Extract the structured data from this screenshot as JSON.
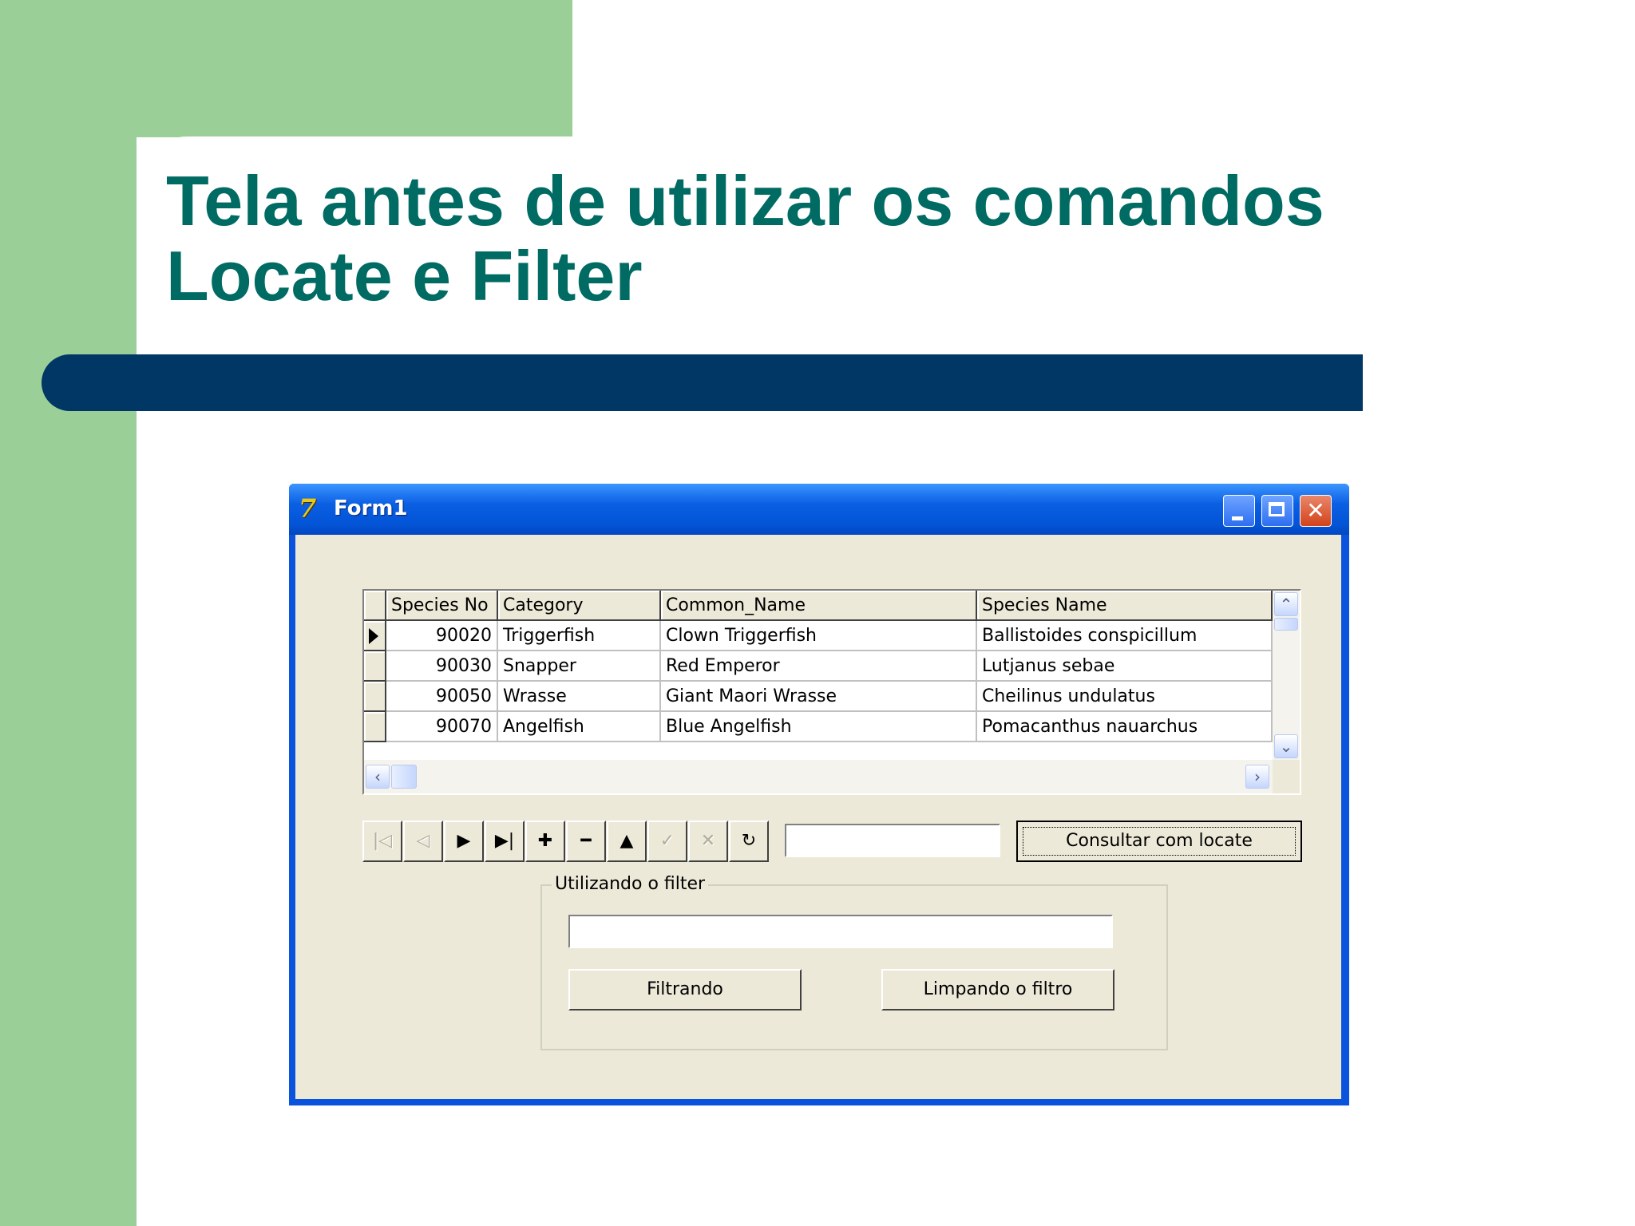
{
  "slide": {
    "title_line1": "Tela antes de utilizar os comandos",
    "title_line2": "Locate e Filter"
  },
  "window": {
    "title": "Form1",
    "icon": "delphi-app-icon",
    "controls": {
      "minimize": "minimize-icon",
      "maximize": "maximize-icon",
      "close": "✕"
    }
  },
  "grid": {
    "columns": [
      "Species No",
      "Category",
      "Common_Name",
      "Species Name"
    ],
    "rows": [
      [
        "90020",
        "Triggerfish",
        "Clown Triggerfish",
        "Ballistoides conspicillum"
      ],
      [
        "90030",
        "Snapper",
        "Red Emperor",
        "Lutjanus sebae"
      ],
      [
        "90050",
        "Wrasse",
        "Giant Maori Wrasse",
        "Cheilinus undulatus"
      ],
      [
        "90070",
        "Angelfish",
        "Blue Angelfish",
        "Pomacanthus nauarchus"
      ]
    ],
    "current_row": 0
  },
  "navigator": {
    "buttons": [
      {
        "name": "nav-first-button",
        "glyph": "|◁",
        "enabled": false
      },
      {
        "name": "nav-prior-button",
        "glyph": "◁",
        "enabled": false
      },
      {
        "name": "nav-next-button",
        "glyph": "▶",
        "enabled": true
      },
      {
        "name": "nav-last-button",
        "glyph": "▶|",
        "enabled": true
      },
      {
        "name": "nav-insert-button",
        "glyph": "✚",
        "enabled": true
      },
      {
        "name": "nav-delete-button",
        "glyph": "━",
        "enabled": true
      },
      {
        "name": "nav-edit-button",
        "glyph": "▲",
        "enabled": true
      },
      {
        "name": "nav-post-button",
        "glyph": "✓",
        "enabled": false
      },
      {
        "name": "nav-cancel-button",
        "glyph": "✕",
        "enabled": false
      },
      {
        "name": "nav-refresh-button",
        "glyph": "↻",
        "enabled": true
      }
    ]
  },
  "locate": {
    "input_value": "",
    "button_label": "Consultar com locate"
  },
  "filter_group": {
    "legend": "Utilizando o filter",
    "input_value": "",
    "filter_button": "Filtrando",
    "clear_button": "Limpando o filtro"
  },
  "colors": {
    "slide_green": "#9bcf98",
    "title_teal": "#006b63",
    "bar_navy": "#003764",
    "xp_blue": "#0a53dd",
    "form_face": "#ece9d8"
  }
}
